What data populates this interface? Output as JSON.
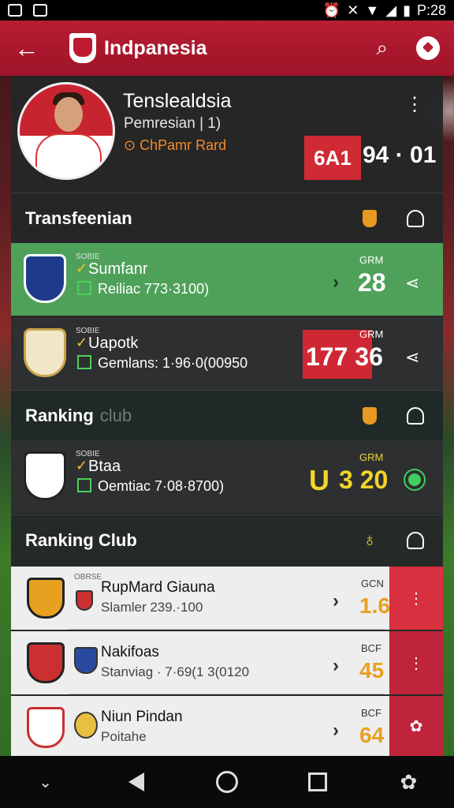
{
  "status": {
    "time": "P:28"
  },
  "appbar": {
    "title": "Indpanesia",
    "back_glyph": "←",
    "search_glyph": "⌕"
  },
  "profile": {
    "name": "Tenslealdsia",
    "position": "Pemresian |        1)",
    "club": "⊙ ChPamr Rard",
    "more": "⋮",
    "badge": "6A1",
    "score": "94 · 01"
  },
  "sections": [
    {
      "title": "Transfeenian",
      "sub": ""
    },
    {
      "title": "Ranking",
      "sub": "club"
    },
    {
      "title": "Ranking Club",
      "sub": ""
    }
  ],
  "transfer_rows": [
    {
      "tiny": "SOBIE",
      "name": "Sumfanr",
      "detail": "Reiliac 773·3100)",
      "gk": "GRM",
      "stat": "28",
      "arrow": "›",
      "share": "⋖"
    },
    {
      "tiny": "SOBIE",
      "name": "Uapotk",
      "detail": "Gemlans: 1·96·0(00950",
      "gk": "GRM",
      "stat": "177 36",
      "arrow": "",
      "share": "⋖"
    }
  ],
  "ranking_row": {
    "tiny": "SOBIE",
    "name": "Btaa",
    "detail": "Oemtiac 7·08·8700)",
    "gk": "GRM",
    "u": "U",
    "stat": "3 20"
  },
  "club_rows": [
    {
      "tiny": "OBRSE",
      "name": "RupMard Giauna",
      "detail": "Slamler  239.·100",
      "gk": "GCN",
      "stat": "1.6",
      "btn": "⋮"
    },
    {
      "tiny": "",
      "name": "Nakifoas",
      "detail": "Stanviag · 7·69(1 3(0120",
      "gk": "BCF",
      "stat": "45",
      "btn": "⋮"
    },
    {
      "tiny": "",
      "name": "Niun Pindan",
      "detail": "Poitahe",
      "gk": "BCF",
      "stat": "64",
      "btn": "✿"
    }
  ],
  "icons": {
    "search": "search-icon",
    "settings": "soccer-ball-icon",
    "bag": "bag-icon",
    "user": "user-icon",
    "share": "share-icon"
  },
  "colors": {
    "brand": "#b81d33",
    "transfer_green": "#4fa15a",
    "accent_yellow": "#f2d52a",
    "stat_orange": "#e8a020"
  }
}
